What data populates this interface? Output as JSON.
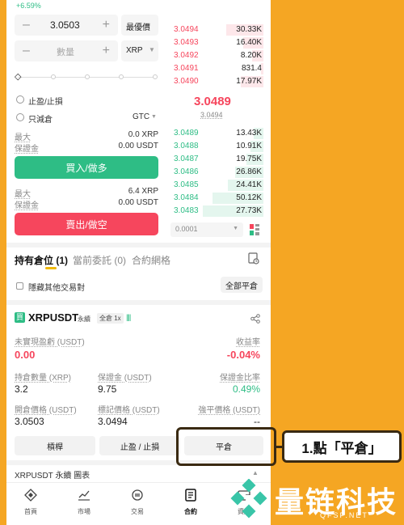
{
  "top_change": "+6.59%",
  "order_form": {
    "price_value": "3.0503",
    "price_mode": "最優價",
    "qty_placeholder": "數量",
    "unit": "XRP",
    "tp_sl_label": "止盈/止損",
    "reduce_only_label": "只減倉",
    "tif": "GTC",
    "buy_max_label": "最大",
    "buy_max_value": "0.0 XRP",
    "buy_margin_label": "保證金",
    "buy_margin_value": "0.00 USDT",
    "buy_button": "買入/做多",
    "sell_max_label": "最大",
    "sell_max_value": "6.4 XRP",
    "sell_margin_label": "保證金",
    "sell_margin_value": "0.00 USDT",
    "sell_button": "賣出/做空"
  },
  "order_book": {
    "asks": [
      {
        "price": "3.0494",
        "qty": "30.33K",
        "depth": 0.4
      },
      {
        "price": "3.0493",
        "qty": "16.40K",
        "depth": 0.22
      },
      {
        "price": "3.0492",
        "qty": "8.20K",
        "depth": 0.12
      },
      {
        "price": "3.0491",
        "qty": "831.4",
        "depth": 0.03
      },
      {
        "price": "3.0490",
        "qty": "17.97K",
        "depth": 0.24
      }
    ],
    "last_price": "3.0489",
    "mark_price": "3.0494",
    "bids": [
      {
        "price": "3.0489",
        "qty": "13.43K",
        "depth": 0.1
      },
      {
        "price": "3.0488",
        "qty": "10.91K",
        "depth": 0.14
      },
      {
        "price": "3.0487",
        "qty": "19.75K",
        "depth": 0.18
      },
      {
        "price": "3.0486",
        "qty": "26.86K",
        "depth": 0.3
      },
      {
        "price": "3.0485",
        "qty": "24.41K",
        "depth": 0.38
      },
      {
        "price": "3.0484",
        "qty": "50.12K",
        "depth": 0.55
      },
      {
        "price": "3.0483",
        "qty": "27.73K",
        "depth": 0.65
      }
    ],
    "precision": "0.0001"
  },
  "tabs": {
    "positions": "持有倉位 (1)",
    "open_orders": "當前委託 (0)",
    "grid": "合約網格"
  },
  "hide_other_pairs": "隱藏其他交易對",
  "close_all": "全部平倉",
  "position": {
    "badge": "買",
    "symbol": "XRPUSDT",
    "type": "永續",
    "leverage": "全倉 1x",
    "unrealized_label": "未實現盈虧 (USDT)",
    "roi_label": "收益率",
    "unrealized_value": "0.00",
    "roi_value": "-0.04%",
    "size_label": "持倉數量 (XRP)",
    "margin_label": "保證金 (USDT)",
    "margin_ratio_label": "保證金比率",
    "size_value": "3.2",
    "margin_value": "9.75",
    "margin_ratio_value": "0.49%",
    "entry_label": "開倉價格 (USDT)",
    "mark_label": "標記價格 (USDT)",
    "liq_label": "強平價格 (USDT)",
    "entry_value": "3.0503",
    "mark_value": "3.0494",
    "liq_value": "--",
    "btn_leverage": "槓桿",
    "btn_tpsl": "止盈 / 止損",
    "btn_close": "平倉"
  },
  "chart_footer": "XRPUSDT 永續 圖表",
  "nav": {
    "home": "首頁",
    "markets": "市場",
    "trade": "交易",
    "futures": "合約",
    "assets": "資產"
  },
  "callout": "1.點「平倉」",
  "watermark": {
    "name": "量链科技",
    "domain": "QFSP.NET"
  },
  "colors": {
    "background": "#F5A623",
    "buy": "#2EBD85",
    "sell": "#F6465D"
  }
}
